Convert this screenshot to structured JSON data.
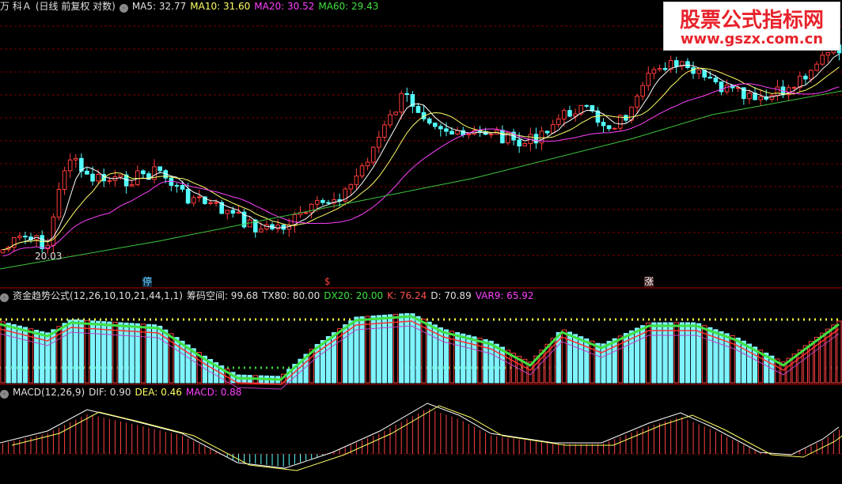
{
  "main_header": {
    "stock": "万 科Ａ",
    "period": "(日线 前复权 对数)",
    "ma5": "MA5: 32.77",
    "ma10": "MA10: 31.60",
    "ma20": "MA20: 30.52",
    "ma60": "MA60: 29.43"
  },
  "watermark": {
    "line1": "股票公式指标网",
    "line2": "www.gszx.com.cn"
  },
  "low_label": "20.03",
  "markers": [
    {
      "text": "停",
      "color": "#66ccff"
    },
    {
      "text": "$",
      "color": "#ff4040"
    },
    {
      "text": "涨",
      "color": "#ffffff"
    }
  ],
  "fund_header": {
    "name": "资金趋势公式(12,26,10,10,21,44,1,1)",
    "chip": "筹码空间: 99.68",
    "tx80": "TX80: 80.00",
    "dx20": "DX20: 20.00",
    "k": "K: 76.24",
    "d": "D: 70.89",
    "var9": "VAR9: 65.92"
  },
  "macd_header": {
    "name": "MACD(12,26,9)",
    "dif": "DIF: 0.90",
    "dea": "DEA: 0.46",
    "macd": "MACD: 0.88"
  },
  "colors": {
    "up": "#ff3c3c",
    "down": "#54ffff",
    "ma5": "#ffffff",
    "ma10": "#ffff66",
    "ma20": "#ff40ff",
    "ma60": "#3ec83e",
    "grid": "#7a0000"
  },
  "chart_data": [
    {
      "type": "candlestick",
      "title": "万 科Ａ (日线 前复权 对数)",
      "series": [
        {
          "name": "MA5",
          "value": 32.77
        },
        {
          "name": "MA10",
          "value": 31.6
        },
        {
          "name": "MA20",
          "value": 30.52
        },
        {
          "name": "MA60",
          "value": 29.43
        }
      ],
      "annotations": [
        "20.03"
      ]
    },
    {
      "type": "bar",
      "title": "资金趋势公式(12,26,10,10,21,44,1,1)",
      "series": [
        {
          "name": "筹码空间",
          "value": 99.68
        },
        {
          "name": "TX80",
          "value": 80.0
        },
        {
          "name": "DX20",
          "value": 20.0
        },
        {
          "name": "K",
          "value": 76.24
        },
        {
          "name": "D",
          "value": 70.89
        },
        {
          "name": "VAR9",
          "value": 65.92
        }
      ]
    },
    {
      "type": "bar",
      "title": "MACD(12,26,9)",
      "series": [
        {
          "name": "DIF",
          "value": 0.9
        },
        {
          "name": "DEA",
          "value": 0.46
        },
        {
          "name": "MACD",
          "value": 0.88
        }
      ]
    }
  ]
}
